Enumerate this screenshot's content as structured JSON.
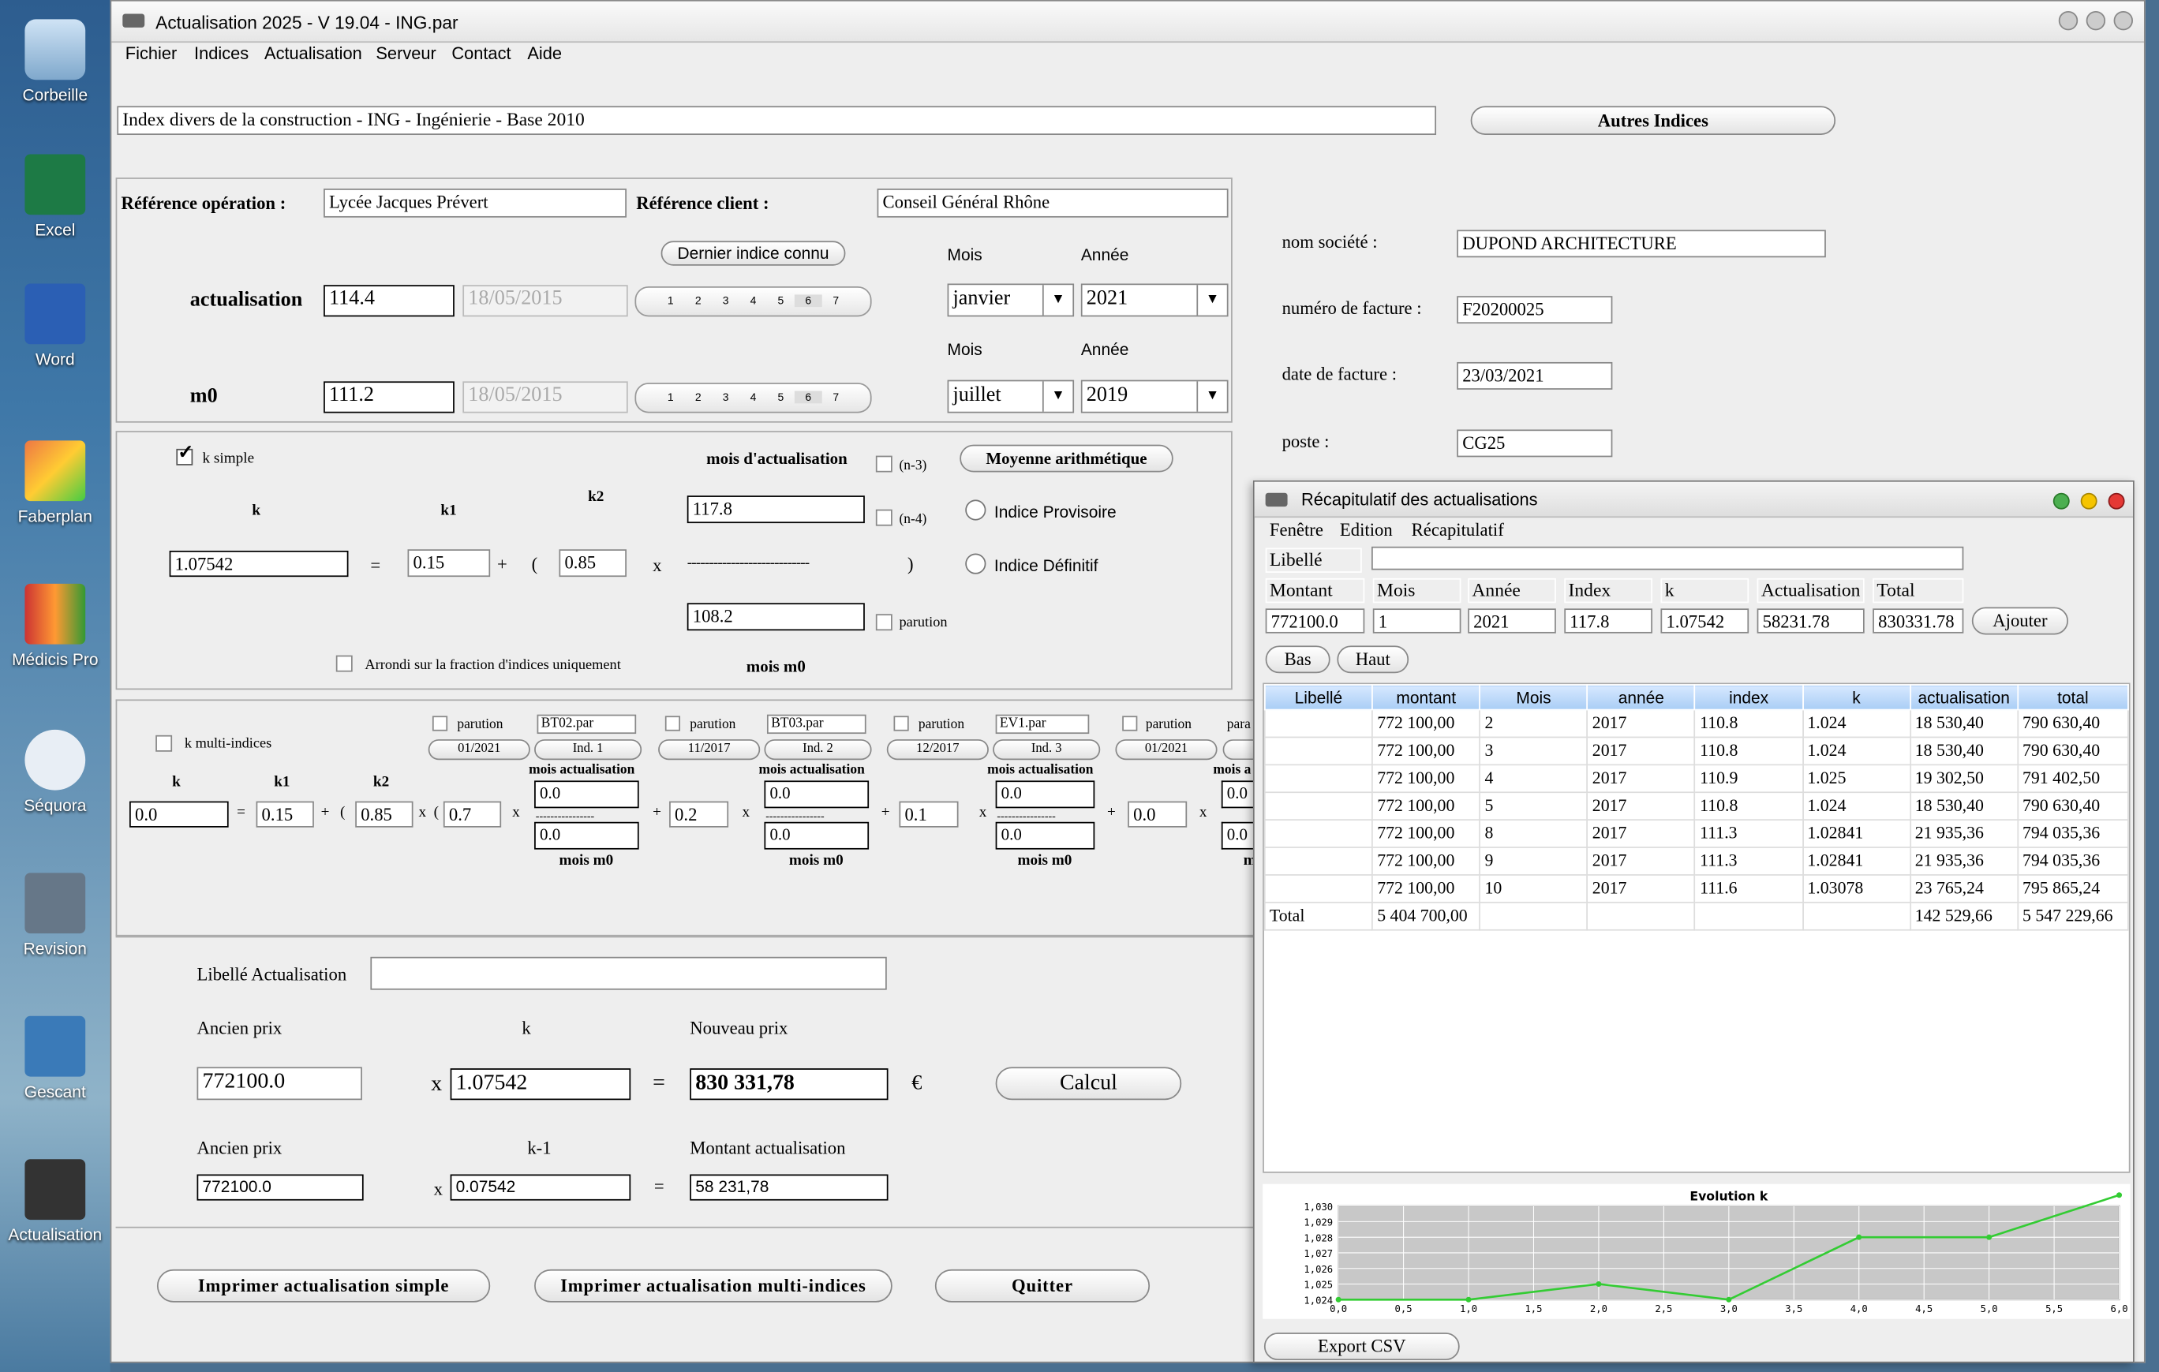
{
  "desktop": {
    "icons": [
      "Corbeille",
      "Excel",
      "Word",
      "Faberplan",
      "Médicis Pro",
      "Séquora",
      "Revision",
      "Gescant",
      "Actualisation"
    ]
  },
  "window": {
    "title": "Actualisation 2025 - V 19.04 - ING.par"
  },
  "menu": [
    "Fichier",
    "Indices",
    "Actualisation",
    "Serveur",
    "Contact",
    "Aide"
  ],
  "index_desc": "Index divers de la construction - ING - Ingénierie - Base 2010",
  "autres_indices": "Autres Indices",
  "ref_op_label": "Référence opération :",
  "ref_op": "Lycée Jacques Prévert",
  "ref_client_label": "Référence client :",
  "ref_client": "Conseil Général Rhône",
  "dernier_indice": "Dernier indice connu",
  "mois_label": "Mois",
  "annee_label": "Année",
  "segments": [
    "1",
    "2",
    "3",
    "4",
    "5",
    "6",
    "7"
  ],
  "actualisation": {
    "label": "actualisation",
    "value": "114.4",
    "date": "18/05/2015",
    "mois": "janvier",
    "annee": "2021"
  },
  "m0": {
    "label": "m0",
    "value": "111.2",
    "date": "18/05/2015",
    "mois": "juillet",
    "annee": "2019"
  },
  "company": {
    "nom_label": "nom société :",
    "nom": "DUPOND ARCHITECTURE",
    "facture_label": "numéro de facture :",
    "facture": "F20200025",
    "date_label": "date de facture :",
    "date": "23/03/2021",
    "poste_label": "poste :",
    "poste": "CG25"
  },
  "ksimple": {
    "label": "k simple",
    "mois_actu": "mois d'actualisation",
    "n3": "(n-3)",
    "n4": "(n-4)",
    "moyenne": "Moyenne arithmétique",
    "provisoire": "Indice Provisoire",
    "definitif": "Indice Définitif",
    "k": "k",
    "k1": "k1",
    "k2": "k2",
    "k_val": "1.07542",
    "k1_val": "0.15",
    "k2_val": "0.85",
    "num": "117.8",
    "den": "108.2",
    "dashes": "----------------------------",
    "parution": "parution",
    "arrondi": "Arrondi sur la fraction d'indices uniquement",
    "mois_m0": "mois m0",
    "eq": "=",
    "plus": "+",
    "x": "x",
    "open": "(",
    "close": ")"
  },
  "multi": {
    "label": "k multi-indices",
    "k": "k",
    "k1": "k1",
    "k2": "k2",
    "k_val": "0.0",
    "k1_val": "0.15",
    "k2_val": "0.85",
    "c1": "0.7",
    "c2": "0.2",
    "c3": "0.1",
    "c4": "0.0",
    "mois_actu": "mois actualisation",
    "mois_m0": "mois m0",
    "mois_a_cut": "mois a",
    "m_cut": "m",
    "parution": "parution",
    "para_cut": "para",
    "dashes": "----------------",
    "val": "0.0",
    "blocks": [
      {
        "file": "BT02.par",
        "date": "01/2021",
        "ind": "Ind. 1"
      },
      {
        "file": "BT03.par",
        "date": "11/2017",
        "ind": "Ind. 2"
      },
      {
        "file": "EV1.par",
        "date": "12/2017",
        "ind": "Ind. 3"
      },
      {
        "file": "",
        "date": "01/2021",
        "ind": ""
      }
    ]
  },
  "bottom": {
    "libelle_label": "Libellé Actualisation",
    "ancien_label": "Ancien prix",
    "k_label": "k",
    "nouveau_label": "Nouveau prix",
    "ancien": "772100.0",
    "k": "1.07542",
    "nouveau": "830 331,78",
    "euro": "€",
    "calcul": "Calcul",
    "km1_label": "k-1",
    "montant_label": "Montant actualisation",
    "ancien2": "772100.0",
    "km1": "0.07542",
    "montant": "58 231,78",
    "x": "x",
    "eq": "="
  },
  "actions": {
    "print_simple": "Imprimer actualisation simple",
    "print_multi": "Imprimer actualisation multi-indices",
    "quit": "Quitter"
  },
  "recap": {
    "title": "Récapitulatif des actualisations",
    "menu": [
      "Fenêtre",
      "Edition",
      "Récapitulatif"
    ],
    "libelle": "Libellé",
    "fields": [
      "Montant",
      "Mois",
      "Année",
      "Index",
      "k",
      "Actualisation",
      "Total"
    ],
    "values": [
      "772100.0",
      "1",
      "2021",
      "117.8",
      "1.07542",
      "58231.78",
      "830331.78"
    ],
    "ajouter": "Ajouter",
    "bas": "Bas",
    "haut": "Haut",
    "columns": [
      "Libellé",
      "montant",
      "Mois",
      "année",
      "index",
      "k",
      "actualisation",
      "total"
    ],
    "rows": [
      [
        "",
        "772 100,00",
        "2",
        "2017",
        "110.8",
        "1.024",
        "18 530,40",
        "790 630,40"
      ],
      [
        "",
        "772 100,00",
        "3",
        "2017",
        "110.8",
        "1.024",
        "18 530,40",
        "790 630,40"
      ],
      [
        "",
        "772 100,00",
        "4",
        "2017",
        "110.9",
        "1.025",
        "19 302,50",
        "791 402,50"
      ],
      [
        "",
        "772 100,00",
        "5",
        "2017",
        "110.8",
        "1.024",
        "18 530,40",
        "790 630,40"
      ],
      [
        "",
        "772 100,00",
        "8",
        "2017",
        "111.3",
        "1.02841",
        "21 935,36",
        "794 035,36"
      ],
      [
        "",
        "772 100,00",
        "9",
        "2017",
        "111.3",
        "1.02841",
        "21 935,36",
        "794 035,36"
      ],
      [
        "",
        "772 100,00",
        "10",
        "2017",
        "111.6",
        "1.03078",
        "23 765,24",
        "795 865,24"
      ],
      [
        "Total",
        "5 404 700,00",
        "",
        "",
        "",
        "",
        "142 529,66",
        "5 547 229,66"
      ]
    ],
    "export": "Export CSV"
  },
  "chart_data": {
    "type": "line",
    "title": "Evolution k",
    "x": [
      0,
      1,
      2,
      3,
      4,
      5,
      6
    ],
    "values": [
      1.024,
      1.024,
      1.025,
      1.024,
      1.028,
      1.028,
      1.0307
    ],
    "xticks": [
      "0,0",
      "0,5",
      "1,0",
      "1,5",
      "2,0",
      "2,5",
      "3,0",
      "3,5",
      "4,0",
      "4,5",
      "5,0",
      "5,5",
      "6,0"
    ],
    "yticks": [
      "1,024",
      "1,025",
      "1,026",
      "1,027",
      "1,028",
      "1,029",
      "1,030"
    ],
    "xlim": [
      0,
      6
    ],
    "ylim": [
      1.024,
      1.03
    ],
    "color": "#33cc33"
  }
}
